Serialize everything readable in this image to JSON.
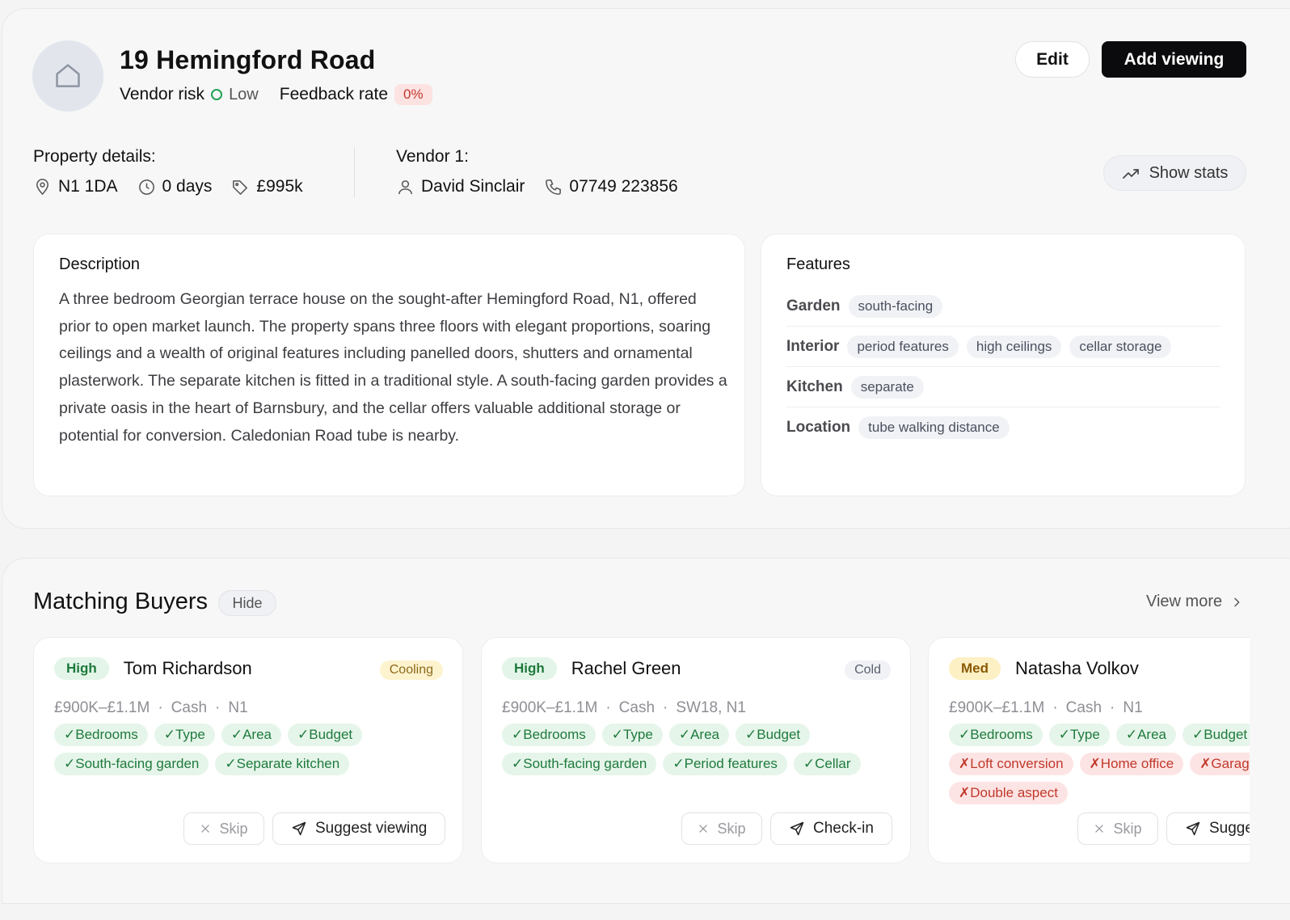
{
  "property": {
    "title": "19 Hemingford Road",
    "vendor_risk_label": "Vendor risk",
    "vendor_risk_value": "Low",
    "feedback_rate_label": "Feedback rate",
    "feedback_rate_value": "0%"
  },
  "actions": {
    "edit_label": "Edit",
    "add_viewing_label": "Add viewing",
    "show_stats_label": "Show stats"
  },
  "details": {
    "label": "Property details:",
    "postcode": "N1 1DA",
    "days": "0 days",
    "price": "£995k"
  },
  "vendor": {
    "label": "Vendor 1:",
    "name": "David Sinclair",
    "phone": "07749 223856"
  },
  "description": {
    "heading": "Description",
    "text": "A three bedroom Georgian terrace house on the sought-after Hemingford Road, N1, offered prior to open market launch. The property spans three floors with elegant proportions, soaring ceilings and a wealth of original features including panelled doors, shutters and ornamental plasterwork. The separate kitchen is fitted in a traditional style. A south-facing garden provides a private oasis in the heart of Barnsbury, and the cellar offers valuable additional storage or potential for conversion. Caledonian Road tube is nearby."
  },
  "features": {
    "heading": "Features",
    "rows": [
      {
        "name": "Garden",
        "chips": [
          "south-facing"
        ]
      },
      {
        "name": "Interior",
        "chips": [
          "period features",
          "high ceilings",
          "cellar storage"
        ]
      },
      {
        "name": "Kitchen",
        "chips": [
          "separate"
        ]
      },
      {
        "name": "Location",
        "chips": [
          "tube walking distance"
        ]
      }
    ]
  },
  "matching": {
    "title": "Matching Buyers",
    "hide_label": "Hide",
    "view_more_label": "View more"
  },
  "buyers": [
    {
      "tier": "High",
      "name": "Tom Richardson",
      "status": "Cooling",
      "budget": "£900K–£1.1M",
      "finance": "Cash",
      "area": "N1",
      "tags": [
        {
          "text": "✓Bedrooms",
          "ok": true
        },
        {
          "text": "✓Type",
          "ok": true
        },
        {
          "text": "✓Area",
          "ok": true
        },
        {
          "text": "✓Budget",
          "ok": true
        },
        {
          "text": "✓South-facing garden",
          "ok": true
        },
        {
          "text": "✓Separate kitchen",
          "ok": true
        }
      ],
      "skip_label": "Skip",
      "action_label": "Suggest viewing"
    },
    {
      "tier": "High",
      "name": "Rachel Green",
      "status": "Cold",
      "budget": "£900K–£1.1M",
      "finance": "Cash",
      "area": "SW18, N1",
      "tags": [
        {
          "text": "✓Bedrooms",
          "ok": true
        },
        {
          "text": "✓Type",
          "ok": true
        },
        {
          "text": "✓Area",
          "ok": true
        },
        {
          "text": "✓Budget",
          "ok": true
        },
        {
          "text": "✓South-facing garden",
          "ok": true
        },
        {
          "text": "✓Period features",
          "ok": true
        },
        {
          "text": "✓Cellar",
          "ok": true
        }
      ],
      "skip_label": "Skip",
      "action_label": "Check-in"
    },
    {
      "tier": "Med",
      "name": "Natasha Volkov",
      "status": "",
      "budget": "£900K–£1.1M",
      "finance": "Cash",
      "area": "N1",
      "tags": [
        {
          "text": "✓Bedrooms",
          "ok": true
        },
        {
          "text": "✓Type",
          "ok": true
        },
        {
          "text": "✓Area",
          "ok": true
        },
        {
          "text": "✓Budget",
          "ok": true
        },
        {
          "text": "✗Loft conversion",
          "ok": false
        },
        {
          "text": "✗Home office",
          "ok": false
        },
        {
          "text": "✗Garage",
          "ok": false
        },
        {
          "text": "✗Double aspect",
          "ok": false
        }
      ],
      "skip_label": "Skip",
      "action_label": "Suggest viewing"
    }
  ],
  "colors": {
    "accent": "#0b0b0d",
    "match_ok": "#1e7a3c",
    "match_no": "#c0392b",
    "risk_low": "#22a355"
  },
  "icons": [
    "home-icon",
    "location-pin-icon",
    "clock-icon",
    "price-tag-icon",
    "user-icon",
    "phone-icon",
    "trend-chart-icon",
    "chevron-right-icon",
    "close-icon",
    "send-icon"
  ]
}
